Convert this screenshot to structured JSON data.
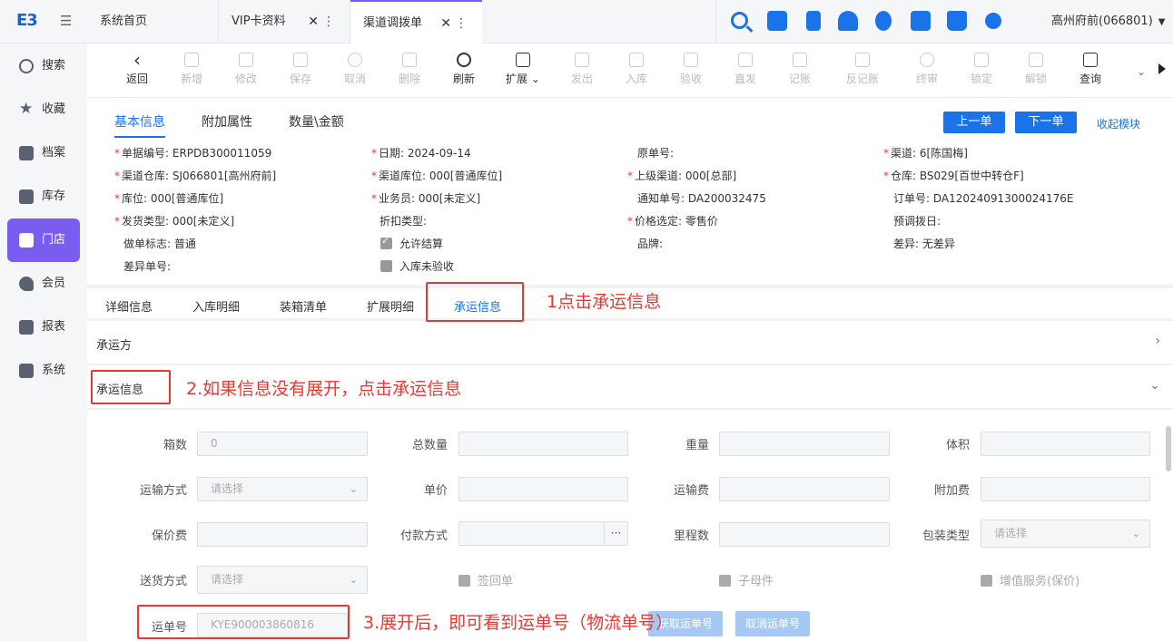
{
  "topbar": {
    "logo": "E3",
    "tabs": [
      {
        "label": "系统首页"
      },
      {
        "label": "VIP卡资料"
      },
      {
        "label": "渠道调拨单"
      }
    ],
    "close_glyph": "✕",
    "more_glyph": "⋮",
    "user": "高州府前(066801)",
    "caret": "▼"
  },
  "sidebar": {
    "items": [
      {
        "label": "搜索",
        "icon": "search-icon"
      },
      {
        "label": "收藏",
        "icon": "star-icon"
      },
      {
        "label": "档案",
        "icon": "archive-icon"
      },
      {
        "label": "库存",
        "icon": "inventory-icon"
      },
      {
        "label": "门店",
        "icon": "store-icon"
      },
      {
        "label": "会员",
        "icon": "rocket-icon"
      },
      {
        "label": "报表",
        "icon": "report-icon"
      },
      {
        "label": "系统",
        "icon": "system-icon"
      }
    ]
  },
  "toolbar": {
    "items": [
      {
        "label": "返回",
        "enabled": true
      },
      {
        "label": "新增",
        "enabled": false
      },
      {
        "label": "修改",
        "enabled": false
      },
      {
        "label": "保存",
        "enabled": false
      },
      {
        "label": "取消",
        "enabled": false
      },
      {
        "label": "删除",
        "enabled": false
      },
      {
        "label": "刷新",
        "enabled": true
      },
      {
        "label": "扩展",
        "enabled": true
      },
      {
        "label": "发出",
        "enabled": false
      },
      {
        "label": "入库",
        "enabled": false
      },
      {
        "label": "验收",
        "enabled": false
      },
      {
        "label": "直发",
        "enabled": false
      },
      {
        "label": "记账",
        "enabled": false
      },
      {
        "label": "反记账",
        "enabled": false
      },
      {
        "label": "终审",
        "enabled": false
      },
      {
        "label": "锁定",
        "enabled": false
      },
      {
        "label": "解锁",
        "enabled": false
      },
      {
        "label": "查询",
        "enabled": true
      }
    ]
  },
  "panel": {
    "tabs": [
      "基本信息",
      "附加属性",
      "数量\\金额"
    ],
    "prev_btn": "上一单",
    "next_btn": "下一单",
    "collapse_link": "收起模块",
    "fields": {
      "doc_no": {
        "label": "单据编号:",
        "value": "ERPDB300011059"
      },
      "date": {
        "label": "日期:",
        "value": "2024-09-14"
      },
      "orig_no": {
        "label": "原单号:",
        "value": ""
      },
      "channel": {
        "label": "渠道:",
        "value": "6[陈国梅]"
      },
      "channel_wh": {
        "label": "渠道仓库:",
        "value": "SJ066801[高州府前]"
      },
      "channel_loc": {
        "label": "渠道库位:",
        "value": "000[普通库位]"
      },
      "parent_channel": {
        "label": "上级渠道:",
        "value": "000[总部]"
      },
      "warehouse": {
        "label": "仓库:",
        "value": "BS029[百世中转仓F]"
      },
      "location": {
        "label": "库位:",
        "value": "000[普通库位]"
      },
      "salesman": {
        "label": "业务员:",
        "value": "000[未定义]"
      },
      "notice_no": {
        "label": "通知单号:",
        "value": "DA200032475"
      },
      "order_no": {
        "label": "订单号:",
        "value": "DA12024091300024176E"
      },
      "ship_type": {
        "label": "发货类型:",
        "value": "000[未定义]"
      },
      "discount_type": {
        "label": "折扣类型:",
        "value": ""
      },
      "price_select": {
        "label": "价格选定:",
        "value": "零售价"
      },
      "pre_transfer": {
        "label": "预调拨日:",
        "value": ""
      },
      "mark": {
        "label": "做单标志:",
        "value": "普通"
      },
      "allow_settle": {
        "label": "允许结算"
      },
      "brand": {
        "label": "品牌:",
        "value": ""
      },
      "diff": {
        "label": "差异:",
        "value": "无差异"
      },
      "diff_no": {
        "label": "差异单号:",
        "value": ""
      },
      "not_checked": {
        "label": "入库未验收"
      }
    }
  },
  "subtabs": [
    "详细信息",
    "入库明细",
    "装箱清单",
    "扩展明细",
    "承运信息"
  ],
  "sections": {
    "carrier": "承运方",
    "shipping_info": "承运信息",
    "arrow_right": "›",
    "arrow_down": "⌄"
  },
  "form": {
    "boxes": {
      "label": "箱数",
      "value": "0"
    },
    "total_qty": {
      "label": "总数量",
      "value": ""
    },
    "weight": {
      "label": "重量",
      "value": ""
    },
    "volume": {
      "label": "体积",
      "value": ""
    },
    "transport": {
      "label": "运输方式",
      "placeholder": "请选择"
    },
    "unit_price": {
      "label": "单价",
      "value": ""
    },
    "freight": {
      "label": "运输费",
      "value": ""
    },
    "extra_fee": {
      "label": "附加费",
      "value": ""
    },
    "insurance": {
      "label": "保价费",
      "value": ""
    },
    "payment": {
      "label": "付款方式",
      "value": ""
    },
    "mileage": {
      "label": "里程数",
      "value": ""
    },
    "pack_type": {
      "label": "包装类型",
      "placeholder": "请选择"
    },
    "delivery": {
      "label": "送货方式",
      "placeholder": "请选择"
    },
    "sign_return": "签回单",
    "parent_child": "子母件",
    "value_added": "增值服务(保价)",
    "waybill": {
      "label": "运单号",
      "value": "KYE900003860816"
    },
    "get_waybill_btn": "获取运单号",
    "cancel_waybill_btn": "取消运单号",
    "dots": "···",
    "dd": "⌄"
  },
  "annotations": {
    "a1": "1点击承运信息",
    "a2": "2.如果信息没有展开，点击承运信息",
    "a3": "3.展开后，即可看到运单号（物流单号）"
  }
}
